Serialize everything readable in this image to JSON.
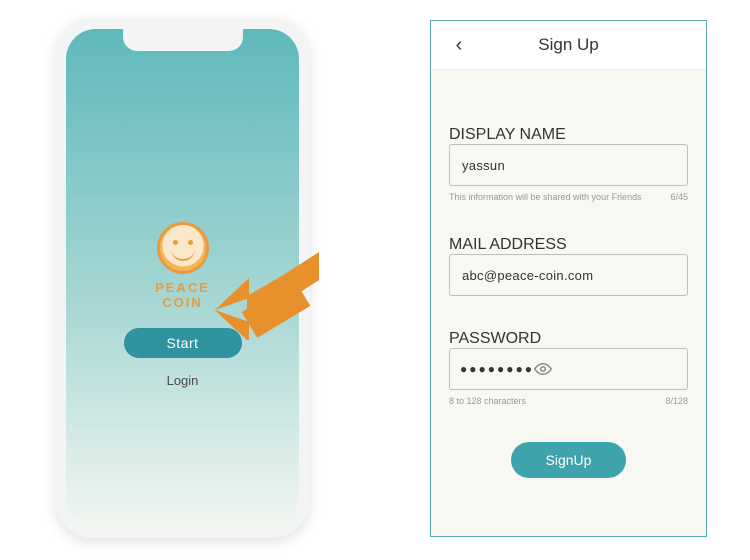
{
  "splash": {
    "brand_line1": "PEACE",
    "brand_line2": "COIN",
    "start_label": "Start",
    "login_label": "Login"
  },
  "signup": {
    "title": "Sign Up",
    "display_name": {
      "label": "DISPLAY NAME",
      "value": "yassun",
      "hint_left": "This information will be shared with your Friends",
      "hint_right": "6/45"
    },
    "mail": {
      "label": "MAIL ADDRESS",
      "value": "abc@peace-coin.com"
    },
    "password": {
      "label": "PASSWORD",
      "masked": "●●●●●●●●",
      "hint_left": "8 to 128 characters",
      "hint_right": "8/128"
    },
    "submit_label": "SignUp"
  }
}
